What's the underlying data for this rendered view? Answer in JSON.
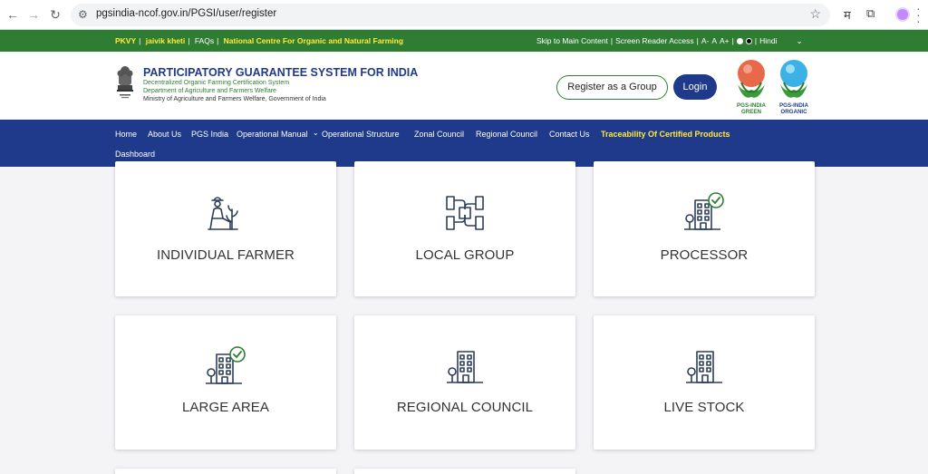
{
  "browser": {
    "url": "pgsindia-ncof.gov.in/PGSI/user/register",
    "ext_hindi": "म"
  },
  "topbar": {
    "left_links": [
      "PKVY",
      "jaivik kheti",
      "FAQs",
      "National Centre For Organic and Natural Farming"
    ],
    "skip": "Skip to Main Content",
    "screen_reader": "Screen Reader Access",
    "font_small": "A-",
    "font_normal": "A",
    "font_large": "A+",
    "language": "Hindi",
    "colors": {
      "bg": "#2e7d32",
      "highlight": "#ffeb3b"
    }
  },
  "header": {
    "title": "PARTICIPATORY GUARANTEE SYSTEM FOR INDIA",
    "sub1": "Decentralized Organic Farming Certification System",
    "sub2": "Department of Agriculture and Farmers Welfare",
    "sub3": "Ministry of Agriculture and Farmers Welfare, Government of India",
    "register_group": "Register as a Group",
    "login": "Login",
    "logo_green": "PGS-INDIA GREEN",
    "logo_organic": "PGS-INDIA ORGANIC"
  },
  "nav": {
    "items": [
      "Home",
      "About Us",
      "PGS India",
      "Operational Manual",
      "Operational Structure",
      "Zonal Council",
      "Regional Council",
      "Contact Us",
      "Traceability Of Certified Products",
      "Dashboard"
    ],
    "colors": {
      "bg": "#1f3a8a"
    }
  },
  "cards": [
    {
      "label": "INDIVIDUAL FARMER",
      "icon": "farmer-icon"
    },
    {
      "label": "LOCAL GROUP",
      "icon": "group-hands-icon"
    },
    {
      "label": "PROCESSOR",
      "icon": "building-check-icon"
    },
    {
      "label": "LARGE AREA",
      "icon": "building-check-icon"
    },
    {
      "label": "REGIONAL COUNCIL",
      "icon": "building-icon"
    },
    {
      "label": "LIVE STOCK",
      "icon": "building-icon"
    }
  ]
}
